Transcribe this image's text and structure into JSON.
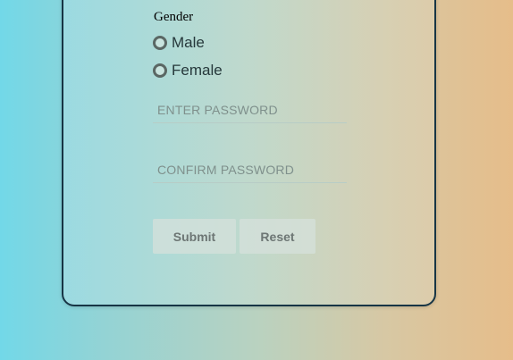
{
  "form": {
    "gender_label": "Gender",
    "gender_options": [
      {
        "label": "Male",
        "selected": false
      },
      {
        "label": "Female",
        "selected": false
      }
    ],
    "password_placeholder": "ENTER PASSWORD",
    "confirm_placeholder": "CONFIRM PASSWORD",
    "submit_label": "Submit",
    "reset_label": "Reset"
  },
  "colors": {
    "card_border": "#173545",
    "radio_border": "#5a6764"
  }
}
